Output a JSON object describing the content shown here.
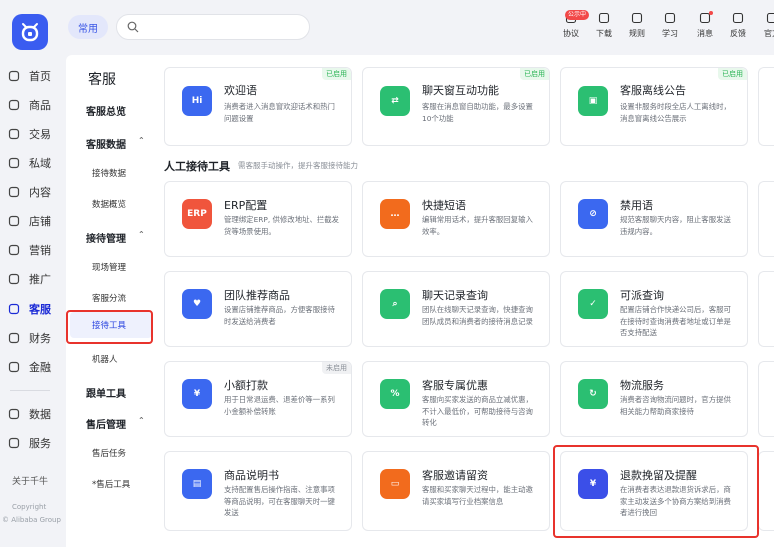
{
  "nav": {
    "items": [
      {
        "key": "home",
        "label": "首页",
        "icon": "home-icon"
      },
      {
        "key": "goods",
        "label": "商品",
        "icon": "goods-icon"
      },
      {
        "key": "trade",
        "label": "交易",
        "icon": "trade-icon"
      },
      {
        "key": "private",
        "label": "私域",
        "icon": "users-icon"
      },
      {
        "key": "content",
        "label": "内容",
        "icon": "hash-icon"
      },
      {
        "key": "shop",
        "label": "店铺",
        "icon": "shop-icon"
      },
      {
        "key": "marketing",
        "label": "营销",
        "icon": "megaphone-icon"
      },
      {
        "key": "promo",
        "label": "推广",
        "icon": "bulb-icon"
      },
      {
        "key": "service",
        "label": "客服",
        "icon": "headset-icon"
      },
      {
        "key": "finance",
        "label": "财务",
        "icon": "yen-icon"
      },
      {
        "key": "money",
        "label": "金融",
        "icon": "coin-icon"
      },
      {
        "key": "data",
        "label": "数据",
        "icon": "chart-icon"
      },
      {
        "key": "services",
        "label": "服务",
        "icon": "grid-icon"
      }
    ],
    "active": "客服",
    "about": "关于千牛",
    "copyright1": "Copyright",
    "copyright2": "© Alibaba Group"
  },
  "topbar": {
    "common_label": "常用",
    "search_placeholder": "",
    "badge": "公示中",
    "tools": [
      {
        "label": "协议",
        "icon": "agreement-icon"
      },
      {
        "label": "下载",
        "icon": "download-icon"
      },
      {
        "label": "规则",
        "icon": "rules-icon"
      },
      {
        "label": "学习",
        "icon": "book-icon"
      },
      {
        "label": "消息",
        "icon": "message-icon"
      },
      {
        "label": "反馈",
        "icon": "feedback-icon"
      },
      {
        "label": "官方",
        "icon": "official-icon"
      }
    ]
  },
  "menu": {
    "title": "客服",
    "overview": "客服总览",
    "data_section": "客服数据",
    "data_items": [
      "接待数据",
      "数据概览"
    ],
    "reception_section": "接待管理",
    "reception_items": [
      "现场管理",
      "客服分流",
      "接待工具",
      "机器人"
    ],
    "order_follow": "跟单工具",
    "aftersale_section": "售后管理",
    "aftersale_items": [
      "售后任务",
      "*售后工具"
    ]
  },
  "section": {
    "title": "人工接待工具",
    "subtitle": "需客服手动操作，提升客服接待能力"
  },
  "cards_top": [
    {
      "title": "欢迎语",
      "desc": "消费者进入消息窗欢迎话术和热门问题设置",
      "tag": "已启用",
      "color": "#3b68f0",
      "glyph": "Hi"
    },
    {
      "title": "聊天窗互动功能",
      "desc": "客服在消息窗自助功能，最多设置10个功能",
      "tag": "已启用",
      "color": "#2bbf72",
      "glyph": "⇄"
    },
    {
      "title": "客服离线公告",
      "desc": "设置非服务时段全店人工离线时，消息窗离线公告展示",
      "tag": "已启用",
      "color": "#2bbf72",
      "glyph": "▣"
    }
  ],
  "cards": [
    {
      "title": "ERP配置",
      "desc": "管理绑定ERP, 供修改地址、拦截发货等场景使用。",
      "tag": "",
      "color": "#f0553c",
      "glyph": "ERP"
    },
    {
      "title": "快捷短语",
      "desc": "编辑常用话术，提升客服回复输入效率。",
      "tag": "",
      "color": "#f26b1d",
      "glyph": "…"
    },
    {
      "title": "禁用语",
      "desc": "规范客服聊天内容，阻止客服发送违规内容。",
      "tag": "",
      "color": "#3b68f0",
      "glyph": "⊘"
    },
    {
      "title": "团队推荐商品",
      "desc": "设置店铺推荐商品，方便客服接待时发送给消费者",
      "tag": "",
      "color": "#3b68f0",
      "glyph": "♥"
    },
    {
      "title": "聊天记录查询",
      "desc": "团队在线聊天记录查询，快捷查询团队成员和消费者的接待消息记录",
      "tag": "",
      "color": "#2bbf72",
      "glyph": "⌕"
    },
    {
      "title": "可派查询",
      "desc": "配置店铺合作快递公司后，客服可在接待时查询消费者地址或订单是否支持配送",
      "tag": "",
      "color": "#2bbf72",
      "glyph": "✓"
    },
    {
      "title": "小额打款",
      "desc": "用于日常退运费、退差价等一系列小金额补偿转账",
      "tag": "未启用",
      "color": "#3b68f0",
      "glyph": "¥"
    },
    {
      "title": "客服专属优惠",
      "desc": "客服向买家发送的商品立减优惠，不计入最低价，可帮助接待与咨询转化",
      "tag": "",
      "color": "#2bbf72",
      "glyph": "%"
    },
    {
      "title": "物流服务",
      "desc": "消费者咨询物流问题时，官方提供相关能力帮助商家接待",
      "tag": "",
      "color": "#2bbf72",
      "glyph": "↻"
    },
    {
      "title": "商品说明书",
      "desc": "支持配置售后操作指南、注意事项等商品说明，可在客服聊天时一键发送",
      "tag": "",
      "color": "#3b68f0",
      "glyph": "▤"
    },
    {
      "title": "客服邀请留资",
      "desc": "客服和买家聊天过程中，能主动邀请买家填写行业档案信息",
      "tag": "",
      "color": "#f26b1d",
      "glyph": "▭"
    },
    {
      "title": "退款挽留及提醒",
      "desc": "在消费者表达退款退货诉求后，商家主动发送多个协商方案给到消费者进行挽回",
      "tag": "",
      "color": "#3b4fe8",
      "glyph": "¥"
    }
  ]
}
